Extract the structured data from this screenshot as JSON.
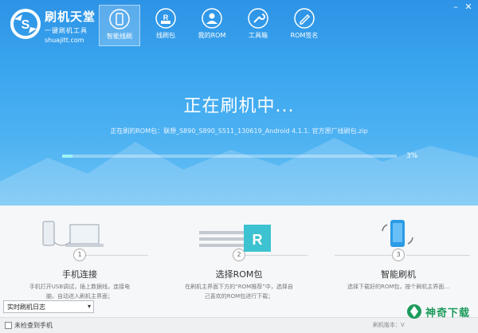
{
  "brand": {
    "name": "刷机天堂",
    "slogan": "一键刷机工具",
    "site": "shuajitt.com"
  },
  "nav": {
    "items": [
      {
        "label": "智能线刷",
        "icon": "smartphone-refresh-icon",
        "active": true
      },
      {
        "label": "线刷包",
        "icon": "rom-package-icon"
      },
      {
        "label": "我的ROM",
        "icon": "user-icon"
      },
      {
        "label": "工具箱",
        "icon": "wrench-icon"
      },
      {
        "label": "ROM签名",
        "icon": "pen-icon"
      }
    ]
  },
  "status": {
    "title": "正在刷机中...",
    "rom_prefix": "正在刷的ROM包：",
    "rom_file": "联想_S890_S890_S511_130619_Android 4.1.1. 官方原厂线刷包.zip",
    "progress_percent": 3,
    "progress_label": "3%"
  },
  "steps": [
    {
      "num": "1",
      "title": "手机连接",
      "desc": "手机打开USB调试，插上数据线，连接电脑，自动进入刷机主界面；"
    },
    {
      "num": "2",
      "title": "选择ROM包",
      "desc": "在刷机主界面下方的“ROM推荐”中，选择自己喜欢的ROM包进行下载；"
    },
    {
      "num": "3",
      "title": "智能刷机",
      "desc": "选择下载好的ROM包，按个刷机主界面..."
    }
  ],
  "log": {
    "selected": "实时刷机日志"
  },
  "footer": {
    "phone_status": "未检查到手机",
    "version": "刷机版本：V"
  },
  "watermark": {
    "text": "神奇下载"
  }
}
